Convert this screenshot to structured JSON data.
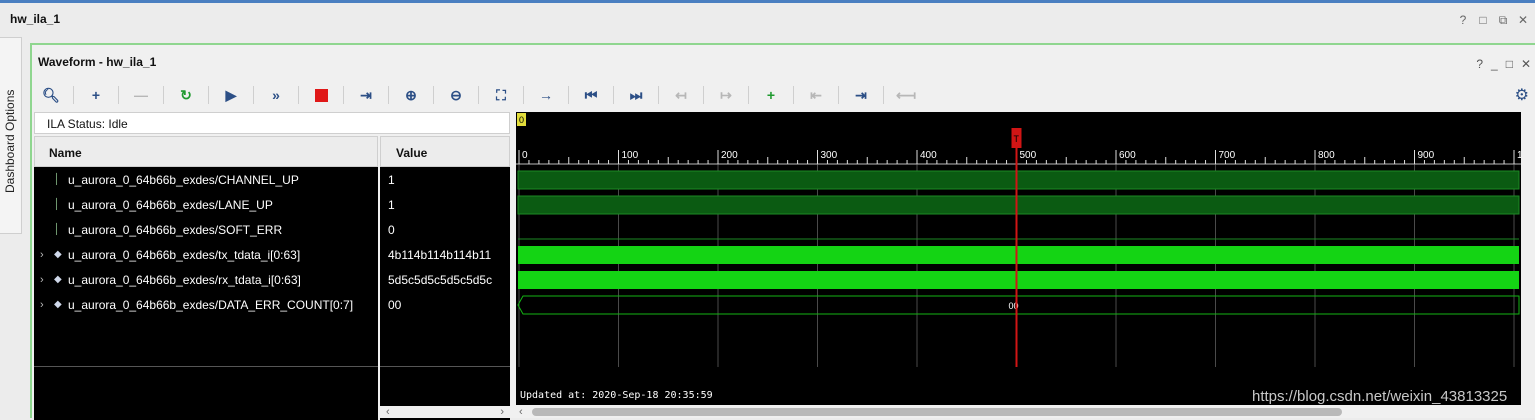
{
  "outer": {
    "title": "hw_ila_1",
    "controls": [
      "?",
      "□",
      "⧉",
      "✕"
    ]
  },
  "side_tab": {
    "label": "Dashboard Options"
  },
  "panel": {
    "title": "Waveform - hw_ila_1",
    "controls": [
      "?",
      "_",
      "□",
      "✕"
    ]
  },
  "toolbar": {
    "icons": [
      "search-icon",
      "add-icon",
      "remove-icon",
      "refresh-icon",
      "run-trigger-icon",
      "run-immediate-icon",
      "stop-icon",
      "export-icon",
      "zoom-in-icon",
      "zoom-out-icon",
      "zoom-fit-icon",
      "go-to-cursor-icon",
      "go-to-start-icon",
      "go-to-end-icon",
      "previous-transition-icon",
      "next-transition-icon",
      "add-marker-icon",
      "previous-marker-icon",
      "next-marker-icon",
      "swap-cursors-icon",
      "settings-icon"
    ]
  },
  "status": {
    "text": "ILA Status:  Idle"
  },
  "columns": {
    "name": "Name",
    "value": "Value"
  },
  "signals": [
    {
      "name": "u_aurora_0_64b66b_exdes/CHANNEL_UP",
      "value": "1",
      "type": "bit",
      "expandable": false
    },
    {
      "name": "u_aurora_0_64b66b_exdes/LANE_UP",
      "value": "1",
      "type": "bit",
      "expandable": false
    },
    {
      "name": "u_aurora_0_64b66b_exdes/SOFT_ERR",
      "value": "0",
      "type": "bit",
      "expandable": false
    },
    {
      "name": "u_aurora_0_64b66b_exdes/tx_tdata_i[0:63]",
      "value": "4b114b114b114b11",
      "type": "bus",
      "expandable": true
    },
    {
      "name": "u_aurora_0_64b66b_exdes/rx_tdata_i[0:63]",
      "value": "5d5c5d5c5d5c5d5c",
      "type": "bus",
      "expandable": true
    },
    {
      "name": "u_aurora_0_64b66b_exdes/DATA_ERR_COUNT[0:7]",
      "value": "00",
      "type": "bus",
      "expandable": true
    }
  ],
  "waveform": {
    "start_marker": "0",
    "trigger_marker": "T",
    "trigger_sample": 500,
    "ruler_labels": [
      "0",
      "100",
      "200",
      "300",
      "400",
      "500",
      "600",
      "700",
      "800",
      "900",
      "1,"
    ],
    "bus_label": "00",
    "updated": "Updated at: 2020-Sep-18 20:35:59",
    "colors": {
      "background": "#000000",
      "high": "#0b5b12",
      "bus": "#14d414",
      "cursor": "#d11515",
      "grid": "#4a4a4a"
    }
  },
  "watermark": "https://blog.csdn.net/weixin_43813325"
}
